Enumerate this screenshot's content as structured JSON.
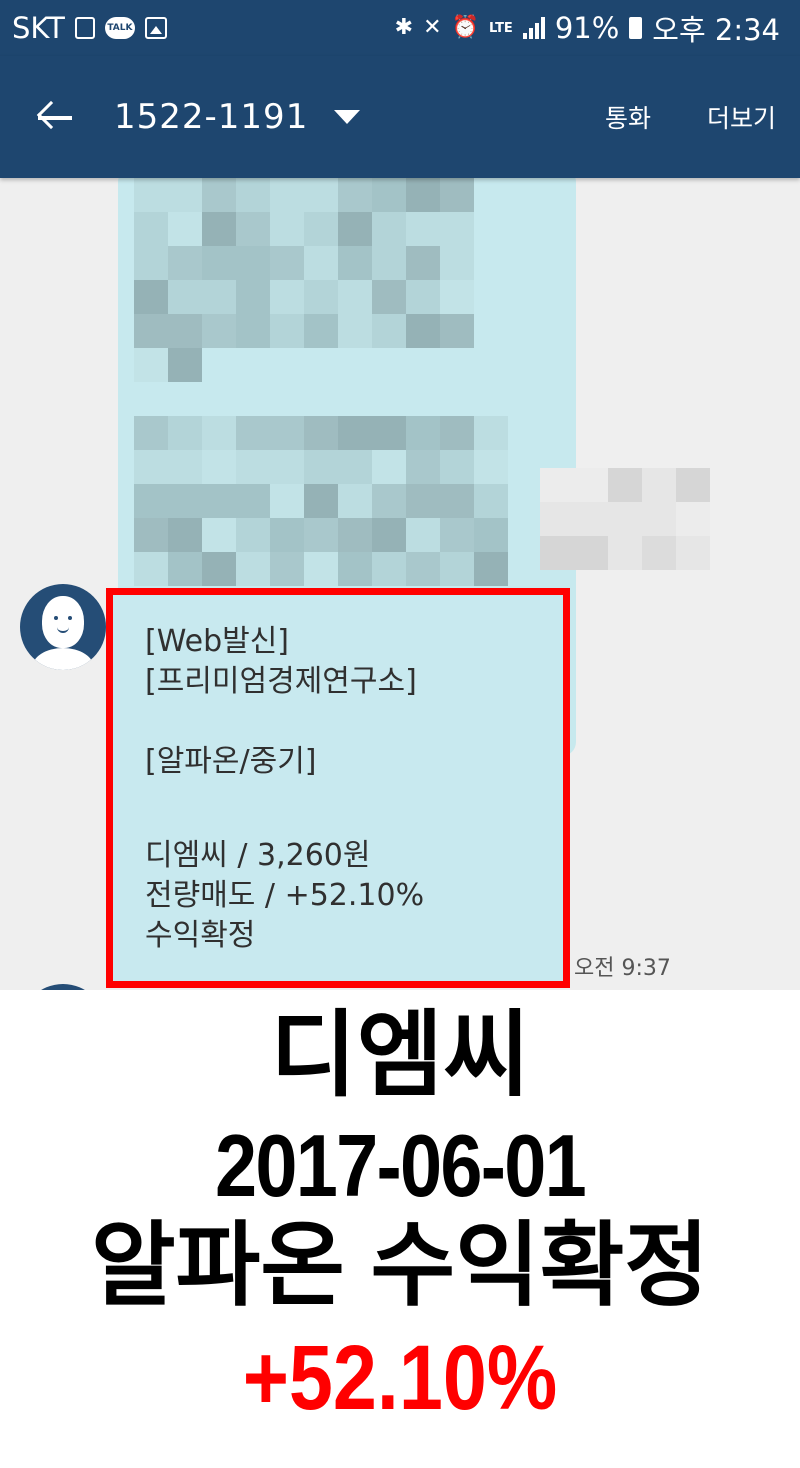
{
  "status_bar": {
    "carrier": "SKT",
    "talk_badge": "TALK",
    "network": "LTE",
    "battery": "91%",
    "time": "오후 2:34"
  },
  "app_bar": {
    "title": "1522-1191",
    "call_label": "통화",
    "more_label": "더보기"
  },
  "message": {
    "lines": [
      "[Web발신]",
      "[프리미엄경제연구소]",
      "",
      "[알파온/중기]",
      "",
      "디엠씨 / 3,260원",
      "전량매도 / +52.10%",
      "수익확정"
    ],
    "time": "오전 9:37",
    "highlight_color": "#ff0000"
  },
  "caption": {
    "stock": "디엠씨",
    "date": "2017-06-01",
    "headline": "알파온 수익확정",
    "return": "+52.10%",
    "return_color": "#ff0000"
  },
  "colors": {
    "app_bar": "#1e466f",
    "bubble": "#c8e9ef",
    "chat_bg": "#efefef"
  }
}
